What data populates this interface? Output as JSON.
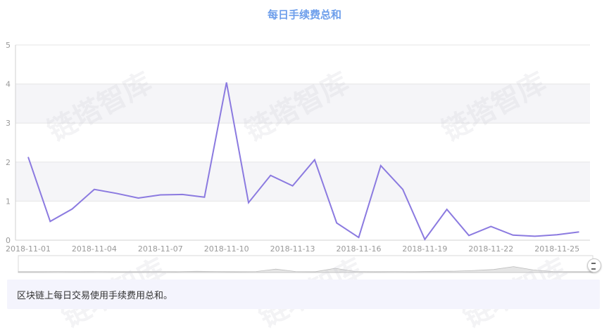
{
  "description": "区块链上每日交易使用手续费用总和。",
  "watermark": "链塔智库",
  "colors": {
    "title": "#6d9eeb",
    "line": "#8b7ae0",
    "grid": "#e6e6e6",
    "axis_text": "#999999"
  },
  "chart_data": {
    "type": "line",
    "title": "每日手续费总和",
    "xlabel": "",
    "ylabel": "",
    "ylim": [
      0,
      5
    ],
    "yticks": [
      0,
      1,
      2,
      3,
      4,
      5
    ],
    "grid": true,
    "x_tick_labels": [
      "2018-11-01",
      "2018-11-04",
      "2018-11-07",
      "2018-11-10",
      "2018-11-13",
      "2018-11-16",
      "2018-11-19",
      "2018-11-22",
      "2018-11-25"
    ],
    "x": [
      "2018-11-01",
      "2018-11-02",
      "2018-11-03",
      "2018-11-04",
      "2018-11-05",
      "2018-11-06",
      "2018-11-07",
      "2018-11-08",
      "2018-11-09",
      "2018-11-10",
      "2018-11-11",
      "2018-11-12",
      "2018-11-13",
      "2018-11-14",
      "2018-11-15",
      "2018-11-16",
      "2018-11-17",
      "2018-11-18",
      "2018-11-19",
      "2018-11-20",
      "2018-11-21",
      "2018-11-22",
      "2018-11-23",
      "2018-11-24",
      "2018-11-25",
      "2018-11-26"
    ],
    "series": [
      {
        "values": [
          2.13,
          0.48,
          0.8,
          1.3,
          1.2,
          1.08,
          1.16,
          1.17,
          1.1,
          4.04,
          0.96,
          1.66,
          1.39,
          2.06,
          0.44,
          0.07,
          1.91,
          1.3,
          0.02,
          0.79,
          0.12,
          0.35,
          0.13,
          0.1,
          0.14,
          0.21
        ]
      }
    ]
  }
}
